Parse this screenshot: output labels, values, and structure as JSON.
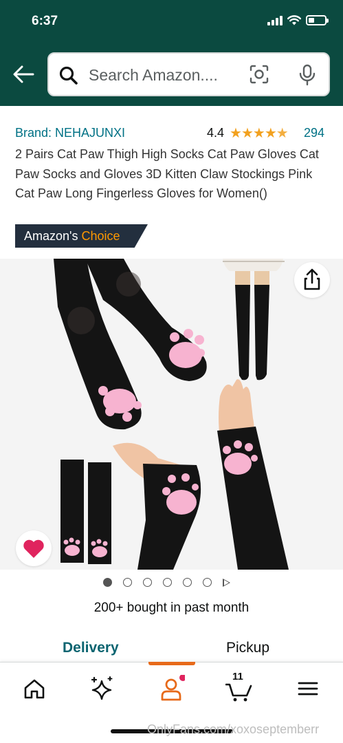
{
  "status_bar": {
    "time": "6:37",
    "battery_level": 0.35
  },
  "search": {
    "placeholder": "Search Amazon...."
  },
  "product": {
    "brand": "Brand: NEHAJUNXI",
    "rating": "4.4",
    "rating_stars": 4.4,
    "rating_count": "294",
    "title": "2 Pairs Cat Paw Thigh High Socks Cat Paw Gloves Cat Paw Socks and Gloves 3D Kitten Claw Stockings Pink Cat Paw Long Fingerless Gloves for Women()",
    "badge": {
      "prefix": "Amazon's",
      "accent": "Choice"
    },
    "bought": "200+ bought in past month"
  },
  "gallery": {
    "image_count": 6,
    "active_index": 0,
    "has_video": true
  },
  "delivery_tabs": {
    "delivery": "Delivery",
    "pickup": "Pickup"
  },
  "bottom_nav": {
    "items": [
      "home-icon",
      "sparkle-icon",
      "account-icon",
      "cart-icon",
      "menu-icon"
    ],
    "active": "account-icon",
    "cart_count": "11"
  },
  "watermark": "OnlyFans.com/xoxoseptemberr",
  "colors": {
    "header": "#0b4a40",
    "link": "#007185",
    "star": "#f2a11f",
    "badge_bg": "#232f3e",
    "badge_accent": "#ff9900",
    "active_tab": "#0b6470",
    "nav_active": "#e76a1a",
    "heart": "#e0245e"
  }
}
